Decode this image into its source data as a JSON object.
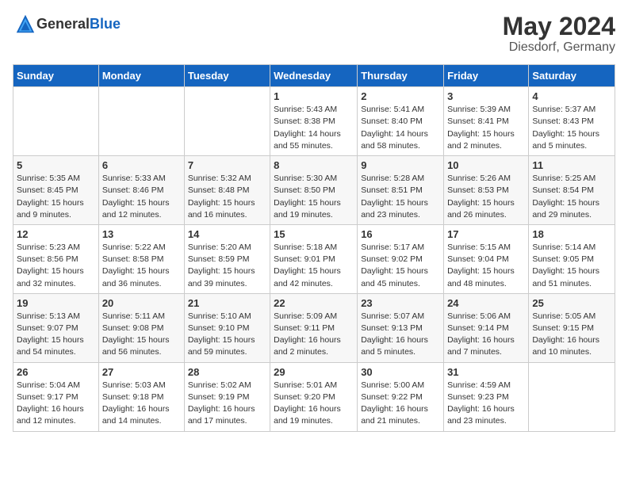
{
  "header": {
    "logo_general": "General",
    "logo_blue": "Blue",
    "title": "May 2024",
    "subtitle": "Diesdorf, Germany"
  },
  "weekdays": [
    "Sunday",
    "Monday",
    "Tuesday",
    "Wednesday",
    "Thursday",
    "Friday",
    "Saturday"
  ],
  "weeks": [
    [
      {
        "day": "",
        "info": ""
      },
      {
        "day": "",
        "info": ""
      },
      {
        "day": "",
        "info": ""
      },
      {
        "day": "1",
        "info": "Sunrise: 5:43 AM\nSunset: 8:38 PM\nDaylight: 14 hours\nand 55 minutes."
      },
      {
        "day": "2",
        "info": "Sunrise: 5:41 AM\nSunset: 8:40 PM\nDaylight: 14 hours\nand 58 minutes."
      },
      {
        "day": "3",
        "info": "Sunrise: 5:39 AM\nSunset: 8:41 PM\nDaylight: 15 hours\nand 2 minutes."
      },
      {
        "day": "4",
        "info": "Sunrise: 5:37 AM\nSunset: 8:43 PM\nDaylight: 15 hours\nand 5 minutes."
      }
    ],
    [
      {
        "day": "5",
        "info": "Sunrise: 5:35 AM\nSunset: 8:45 PM\nDaylight: 15 hours\nand 9 minutes."
      },
      {
        "day": "6",
        "info": "Sunrise: 5:33 AM\nSunset: 8:46 PM\nDaylight: 15 hours\nand 12 minutes."
      },
      {
        "day": "7",
        "info": "Sunrise: 5:32 AM\nSunset: 8:48 PM\nDaylight: 15 hours\nand 16 minutes."
      },
      {
        "day": "8",
        "info": "Sunrise: 5:30 AM\nSunset: 8:50 PM\nDaylight: 15 hours\nand 19 minutes."
      },
      {
        "day": "9",
        "info": "Sunrise: 5:28 AM\nSunset: 8:51 PM\nDaylight: 15 hours\nand 23 minutes."
      },
      {
        "day": "10",
        "info": "Sunrise: 5:26 AM\nSunset: 8:53 PM\nDaylight: 15 hours\nand 26 minutes."
      },
      {
        "day": "11",
        "info": "Sunrise: 5:25 AM\nSunset: 8:54 PM\nDaylight: 15 hours\nand 29 minutes."
      }
    ],
    [
      {
        "day": "12",
        "info": "Sunrise: 5:23 AM\nSunset: 8:56 PM\nDaylight: 15 hours\nand 32 minutes."
      },
      {
        "day": "13",
        "info": "Sunrise: 5:22 AM\nSunset: 8:58 PM\nDaylight: 15 hours\nand 36 minutes."
      },
      {
        "day": "14",
        "info": "Sunrise: 5:20 AM\nSunset: 8:59 PM\nDaylight: 15 hours\nand 39 minutes."
      },
      {
        "day": "15",
        "info": "Sunrise: 5:18 AM\nSunset: 9:01 PM\nDaylight: 15 hours\nand 42 minutes."
      },
      {
        "day": "16",
        "info": "Sunrise: 5:17 AM\nSunset: 9:02 PM\nDaylight: 15 hours\nand 45 minutes."
      },
      {
        "day": "17",
        "info": "Sunrise: 5:15 AM\nSunset: 9:04 PM\nDaylight: 15 hours\nand 48 minutes."
      },
      {
        "day": "18",
        "info": "Sunrise: 5:14 AM\nSunset: 9:05 PM\nDaylight: 15 hours\nand 51 minutes."
      }
    ],
    [
      {
        "day": "19",
        "info": "Sunrise: 5:13 AM\nSunset: 9:07 PM\nDaylight: 15 hours\nand 54 minutes."
      },
      {
        "day": "20",
        "info": "Sunrise: 5:11 AM\nSunset: 9:08 PM\nDaylight: 15 hours\nand 56 minutes."
      },
      {
        "day": "21",
        "info": "Sunrise: 5:10 AM\nSunset: 9:10 PM\nDaylight: 15 hours\nand 59 minutes."
      },
      {
        "day": "22",
        "info": "Sunrise: 5:09 AM\nSunset: 9:11 PM\nDaylight: 16 hours\nand 2 minutes."
      },
      {
        "day": "23",
        "info": "Sunrise: 5:07 AM\nSunset: 9:13 PM\nDaylight: 16 hours\nand 5 minutes."
      },
      {
        "day": "24",
        "info": "Sunrise: 5:06 AM\nSunset: 9:14 PM\nDaylight: 16 hours\nand 7 minutes."
      },
      {
        "day": "25",
        "info": "Sunrise: 5:05 AM\nSunset: 9:15 PM\nDaylight: 16 hours\nand 10 minutes."
      }
    ],
    [
      {
        "day": "26",
        "info": "Sunrise: 5:04 AM\nSunset: 9:17 PM\nDaylight: 16 hours\nand 12 minutes."
      },
      {
        "day": "27",
        "info": "Sunrise: 5:03 AM\nSunset: 9:18 PM\nDaylight: 16 hours\nand 14 minutes."
      },
      {
        "day": "28",
        "info": "Sunrise: 5:02 AM\nSunset: 9:19 PM\nDaylight: 16 hours\nand 17 minutes."
      },
      {
        "day": "29",
        "info": "Sunrise: 5:01 AM\nSunset: 9:20 PM\nDaylight: 16 hours\nand 19 minutes."
      },
      {
        "day": "30",
        "info": "Sunrise: 5:00 AM\nSunset: 9:22 PM\nDaylight: 16 hours\nand 21 minutes."
      },
      {
        "day": "31",
        "info": "Sunrise: 4:59 AM\nSunset: 9:23 PM\nDaylight: 16 hours\nand 23 minutes."
      },
      {
        "day": "",
        "info": ""
      }
    ]
  ]
}
